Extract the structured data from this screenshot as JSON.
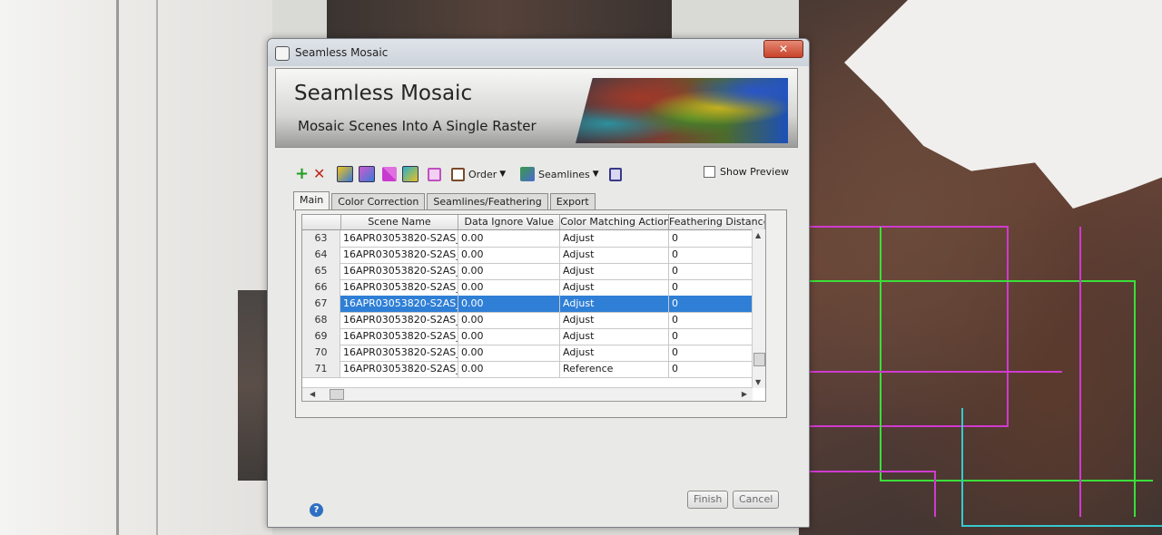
{
  "dialog": {
    "window_title": "Seamless Mosaic",
    "close_label": "✕",
    "banner_title": "Seamless Mosaic",
    "banner_subtitle": "Mosaic Scenes Into A Single Raster"
  },
  "toolbar": {
    "order_label": "Order",
    "seamlines_label": "Seamlines",
    "show_preview_label": "Show Preview",
    "show_preview_checked": false,
    "icons": [
      "add-icon",
      "remove-icon",
      "layer-icon",
      "layer-alt-icon",
      "seamline-icon",
      "footprint-icon",
      "scene-icon",
      "order-icon",
      "seamlines-icon",
      "export-icon"
    ]
  },
  "tabs": [
    {
      "label": "Main",
      "active": true
    },
    {
      "label": "Color Correction",
      "active": false
    },
    {
      "label": "Seamlines/Feathering",
      "active": false
    },
    {
      "label": "Export",
      "active": false
    }
  ],
  "grid": {
    "columns": [
      "Scene Name",
      "Data Ignore Value",
      "Color Matching Action",
      "Feathering Distance"
    ],
    "rows": [
      {
        "index": "63",
        "scene": "16APR03053820-S2AS_",
        "ignore": "0.00",
        "action": "Adjust",
        "feather": "0"
      },
      {
        "index": "64",
        "scene": "16APR03053820-S2AS_",
        "ignore": "0.00",
        "action": "Adjust",
        "feather": "0"
      },
      {
        "index": "65",
        "scene": "16APR03053820-S2AS_",
        "ignore": "0.00",
        "action": "Adjust",
        "feather": "0"
      },
      {
        "index": "66",
        "scene": "16APR03053820-S2AS_",
        "ignore": "0.00",
        "action": "Adjust",
        "feather": "0"
      },
      {
        "index": "67",
        "scene": "16APR03053820-S2AS_",
        "ignore": "0.00",
        "action": "Adjust",
        "feather": "0",
        "selected": true
      },
      {
        "index": "68",
        "scene": "16APR03053820-S2AS_",
        "ignore": "0.00",
        "action": "Adjust",
        "feather": "0"
      },
      {
        "index": "69",
        "scene": "16APR03053820-S2AS_",
        "ignore": "0.00",
        "action": "Adjust",
        "feather": "0"
      },
      {
        "index": "70",
        "scene": "16APR03053820-S2AS_",
        "ignore": "0.00",
        "action": "Adjust",
        "feather": "0"
      },
      {
        "index": "71",
        "scene": "16APR03053820-S2AS_",
        "ignore": "0.00",
        "action": "Reference",
        "feather": "0"
      }
    ]
  },
  "footer": {
    "help_label": "?",
    "finish_label": "Finish",
    "cancel_label": "Cancel"
  },
  "colors": {
    "selection": "#2f7fd6",
    "close_button": "#c8432a",
    "map_boundary_green": "#3adf3a",
    "map_boundary_magenta": "#d03ad0"
  }
}
